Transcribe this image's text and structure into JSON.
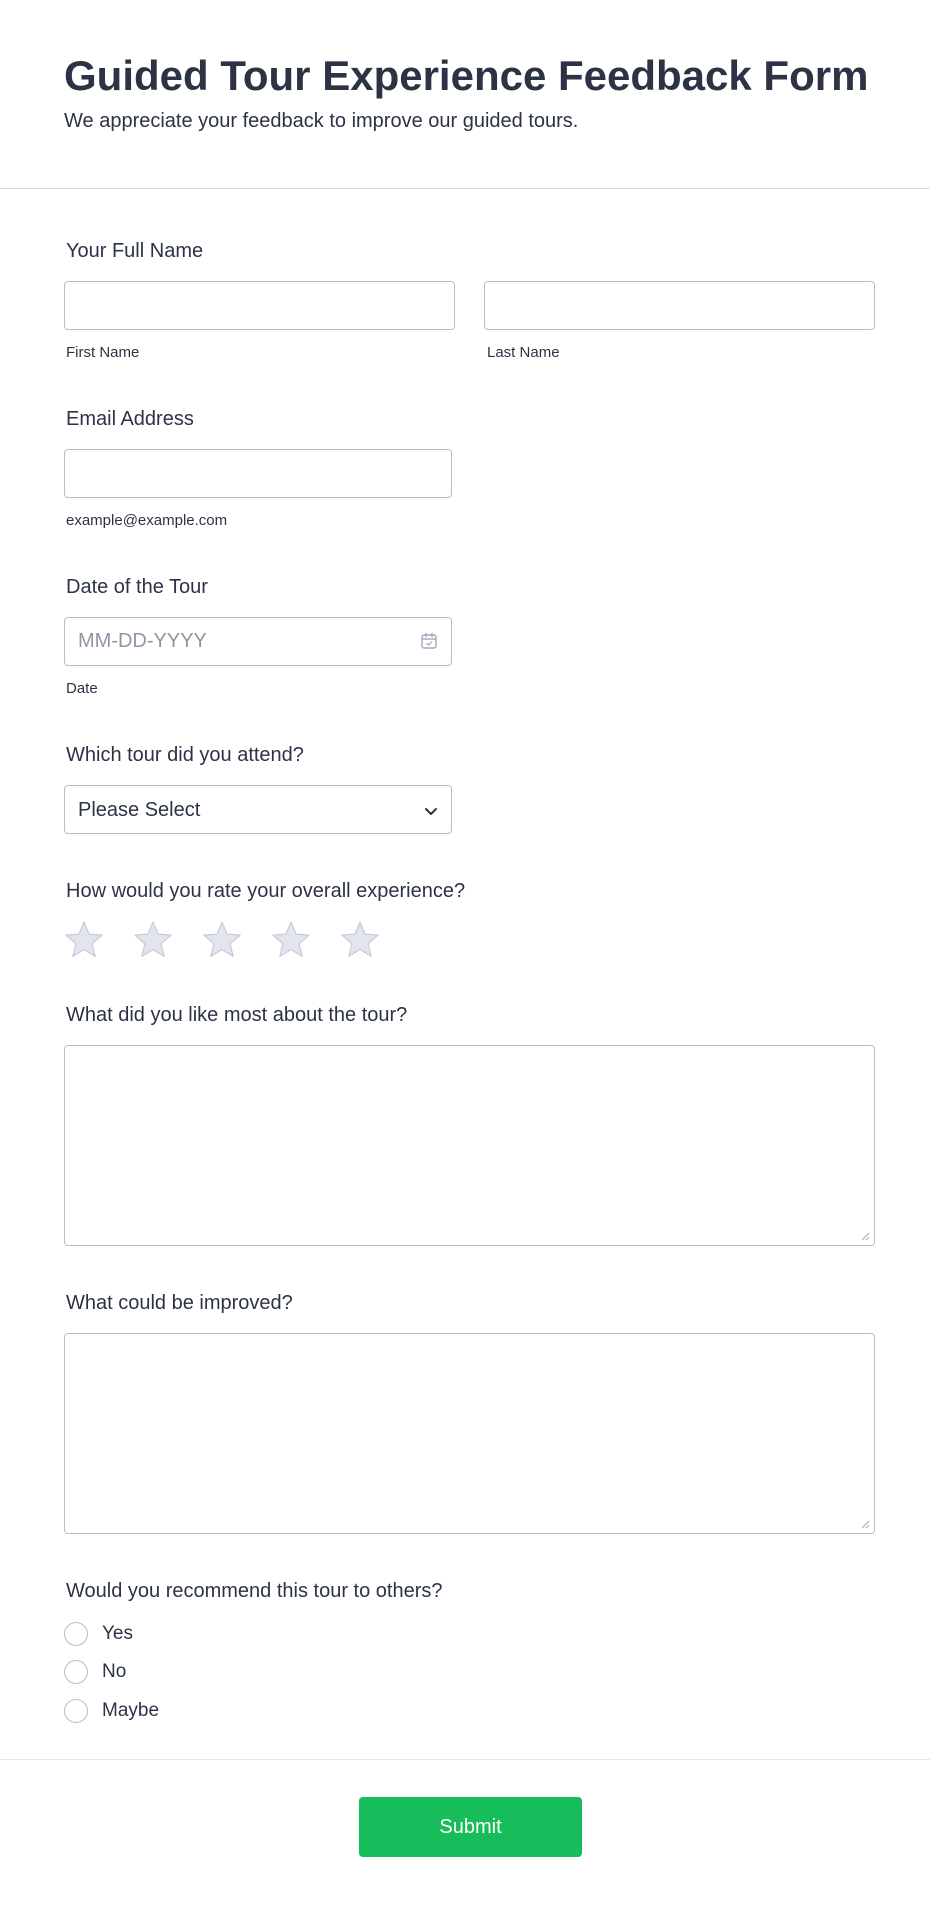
{
  "header": {
    "title": "Guided Tour Experience Feedback Form",
    "subtitle": "We appreciate your feedback to improve our guided tours."
  },
  "full_name": {
    "label": "Your Full Name",
    "first_value": "",
    "first_sublabel": "First Name",
    "last_value": "",
    "last_sublabel": "Last Name"
  },
  "email": {
    "label": "Email Address",
    "value": "",
    "sublabel": "example@example.com"
  },
  "tour_date": {
    "label": "Date of the Tour",
    "placeholder": "MM-DD-YYYY",
    "sublabel": "Date",
    "icon": "calendar-icon"
  },
  "tour_select": {
    "label": "Which tour did you attend?",
    "selected": "Please Select",
    "icon": "chevron-down-icon"
  },
  "rating": {
    "label": "How would you rate your overall experience?",
    "max": 5,
    "value": 0,
    "star_color": "#e3e5ee",
    "star_stroke": "#c7cbd8"
  },
  "liked_most": {
    "label": "What did you like most about the tour?",
    "value": ""
  },
  "improvements": {
    "label": "What could be improved?",
    "value": ""
  },
  "recommend": {
    "label": "Would you recommend this tour to others?",
    "options": [
      "Yes",
      "No",
      "Maybe"
    ]
  },
  "submit_label": "Submit",
  "colors": {
    "text": "#2c3345",
    "border": "#b8bdc9",
    "submit": "#18bd5b"
  }
}
